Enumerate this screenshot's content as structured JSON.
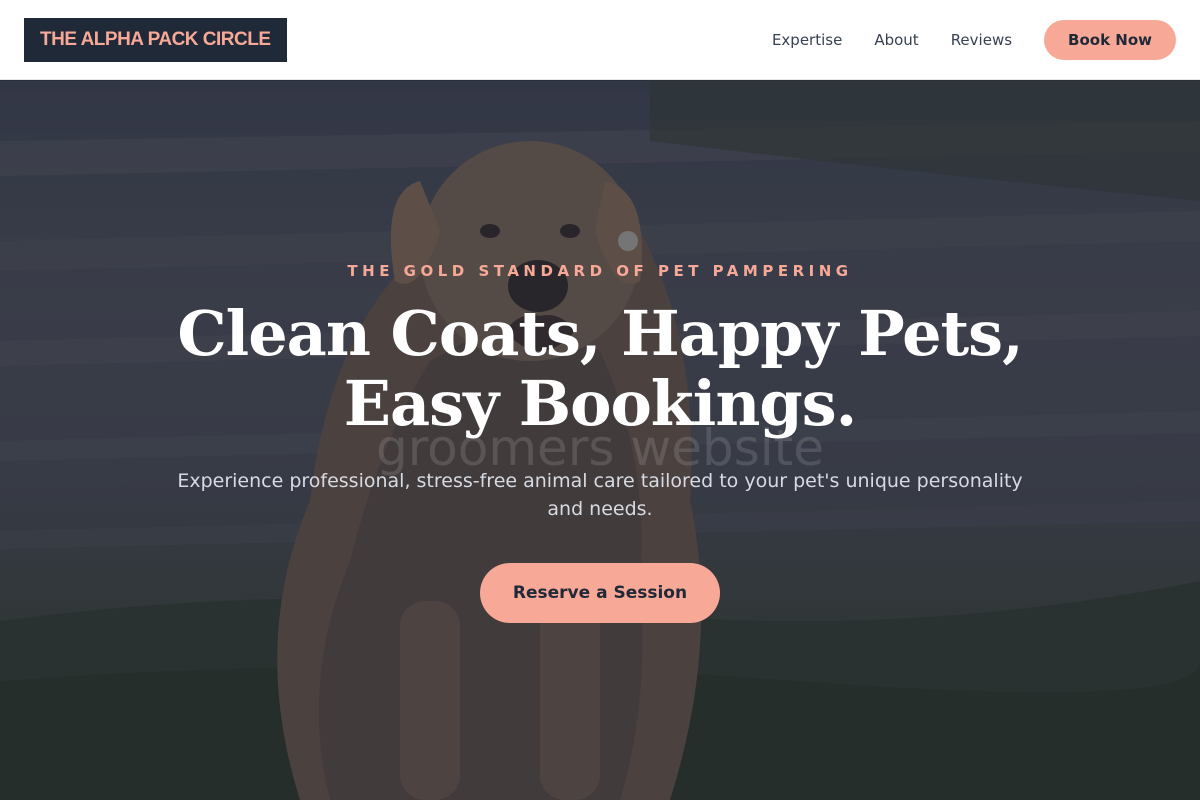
{
  "header": {
    "logo": "THE ALPHA PACK CIRCLE",
    "nav": [
      "Expertise",
      "About",
      "Reviews"
    ],
    "book_now": "Book Now"
  },
  "hero": {
    "eyebrow": "THE GOLD STANDARD OF PET PAMPERING",
    "headline_line1": "Clean Coats, Happy Pets,",
    "headline_line2": "Easy Bookings.",
    "ghost_text": "groomers website",
    "subtext": "Experience professional, stress-free animal care tailored to your pet's unique personality and needs.",
    "cta": "Reserve a Session"
  },
  "colors": {
    "accent": "#f7a896",
    "dark": "#1f2937",
    "overlay": "#262a3a"
  }
}
